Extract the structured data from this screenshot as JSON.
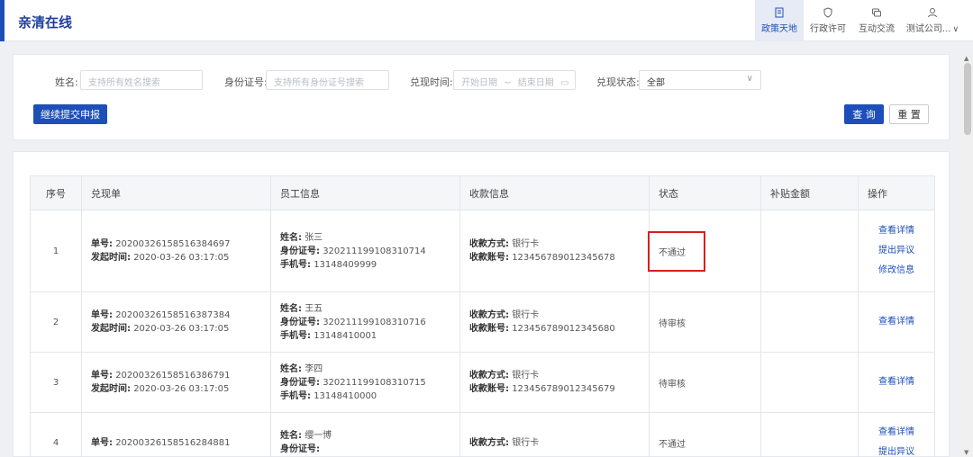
{
  "brand": "亲清在线",
  "nav": [
    {
      "label": "政策天地",
      "icon": "document-icon",
      "active": true
    },
    {
      "label": "行政许可",
      "icon": "shield-icon",
      "active": false
    },
    {
      "label": "互动交流",
      "icon": "chat-icon",
      "active": false
    },
    {
      "label": "测试公司...",
      "icon": "user-icon",
      "active": false
    }
  ],
  "filters": {
    "name_label": "姓名:",
    "name_placeholder": "支持所有姓名搜索",
    "id_label": "身份证号:",
    "id_placeholder": "支持所有身份证号搜索",
    "time_label": "兑现时间:",
    "start_placeholder": "开始日期",
    "range_sep": "~",
    "end_placeholder": "结束日期",
    "status_label": "兑现状态:",
    "status_value": "全部"
  },
  "buttons": {
    "continue": "继续提交申报",
    "query": "查 询",
    "reset": "重 置"
  },
  "table": {
    "headers": [
      "序号",
      "兑现单",
      "员工信息",
      "收款信息",
      "状态",
      "补贴金额",
      "操作"
    ],
    "labels": {
      "order_no": "单号:",
      "start_time": "发起时间:",
      "name": "姓名:",
      "id_no": "身份证号:",
      "phone": "手机号:",
      "pay_method": "收款方式:",
      "account": "收款账号:"
    },
    "rows": [
      {
        "index": "1",
        "order_no": "20200326158516384697",
        "start_time": "2020-03-26 03:17:05",
        "name": "张三",
        "id_no": "320211199108310714",
        "phone": "13148409999",
        "pay_method": "银行卡",
        "account": "123456789012345678",
        "status": "不通过",
        "amount": "",
        "actions": [
          "查看详情",
          "提出异议",
          "修改信息"
        ]
      },
      {
        "index": "2",
        "order_no": "20200326158516387384",
        "start_time": "2020-03-26 03:17:05",
        "name": "王五",
        "id_no": "320211199108310716",
        "phone": "13148410001",
        "pay_method": "银行卡",
        "account": "123456789012345680",
        "status": "待审核",
        "amount": "",
        "actions": [
          "查看详情"
        ]
      },
      {
        "index": "3",
        "order_no": "20200326158516386791",
        "start_time": "2020-03-26 03:17:05",
        "name": "李四",
        "id_no": "320211199108310715",
        "phone": "13148410000",
        "pay_method": "银行卡",
        "account": "123456789012345679",
        "status": "待审核",
        "amount": "",
        "actions": [
          "查看详情"
        ]
      },
      {
        "index": "4",
        "order_no": "20200326158516284881",
        "start_time": "",
        "name": "缨一博",
        "id_no": "",
        "phone": "",
        "pay_method": "银行卡",
        "account": "",
        "status": "不通过",
        "amount": "",
        "actions": [
          "查看详情",
          "提出异议"
        ]
      }
    ]
  },
  "colors": {
    "primary": "#1e4fb8",
    "highlight": "#d81e1e"
  }
}
